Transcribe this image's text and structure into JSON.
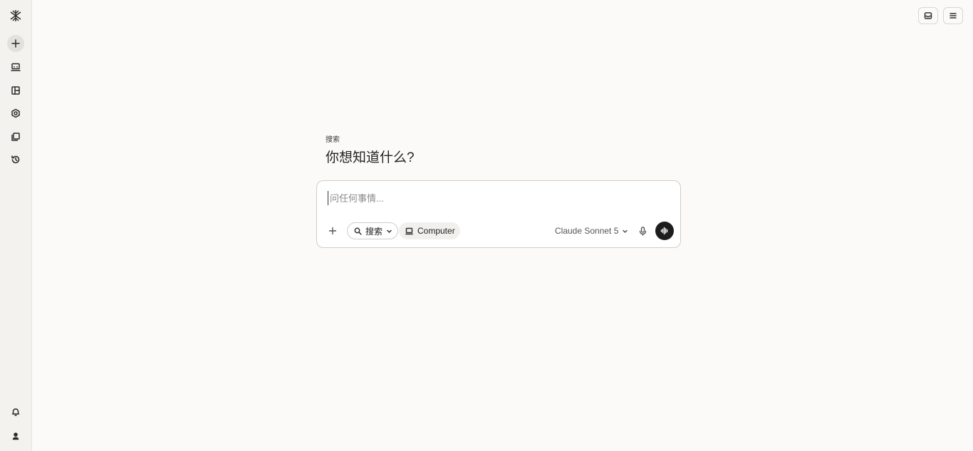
{
  "sidebar": {
    "logo_icon": "snowflake-logo-icon",
    "items": [
      {
        "icon": "plus-icon",
        "name": "new-thread"
      },
      {
        "icon": "computer-icon",
        "name": "computer"
      },
      {
        "icon": "spaces-icon",
        "name": "spaces"
      },
      {
        "icon": "hexagon-settings-icon",
        "name": "discover"
      },
      {
        "icon": "library-icon",
        "name": "library"
      },
      {
        "icon": "history-icon",
        "name": "history"
      }
    ],
    "bottom": [
      {
        "icon": "bell-icon",
        "name": "notifications"
      },
      {
        "icon": "user-icon",
        "name": "account"
      }
    ]
  },
  "topbar": {
    "left_icon": "inbox-icon",
    "right_icon": "menu-icon"
  },
  "hero": {
    "mode_label": "搜索",
    "title": "你想知道什么?"
  },
  "composer": {
    "placeholder": "问任何事情...",
    "value": "",
    "mode_pill_label": "搜索",
    "computer_label": "Computer",
    "model_label": "Claude Sonnet 5"
  }
}
